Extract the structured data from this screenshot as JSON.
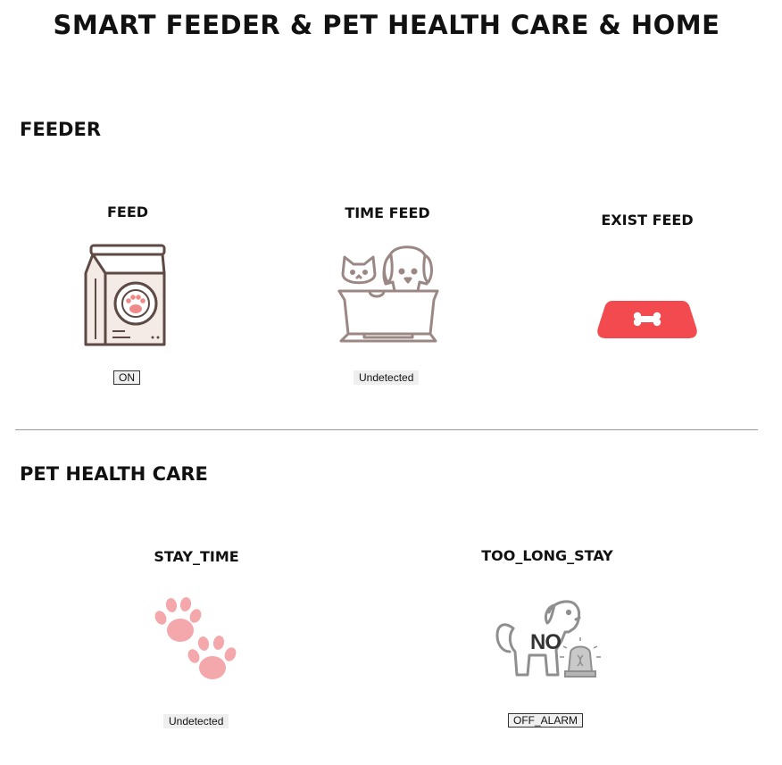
{
  "page": {
    "title": "SMART FEEDER & PET HEALTH CARE & HOME"
  },
  "feeder": {
    "heading": "FEEDER",
    "cards": [
      {
        "title": "FEED",
        "icon": "pet-food-bag-icon",
        "status": "ON"
      },
      {
        "title": "TIME FEED",
        "icon": "cat-and-dog-icon",
        "status": "Undetected"
      },
      {
        "title": "EXIST FEED",
        "icon": "bone-bowl-icon"
      }
    ]
  },
  "health": {
    "heading": "PET HEALTH CARE",
    "cards": [
      {
        "title": "STAY_TIME",
        "icon": "paw-prints-icon",
        "status": "Undetected"
      },
      {
        "title": "TOO_LONG_STAY",
        "icon": "dog-alarm-icon",
        "status": "OFF_ALARM",
        "icon_text": "NO"
      }
    ]
  },
  "colors": {
    "accent_red": "#f24a4f",
    "paw_pink": "#f4a8ab",
    "icon_brown": "#8a7672"
  }
}
